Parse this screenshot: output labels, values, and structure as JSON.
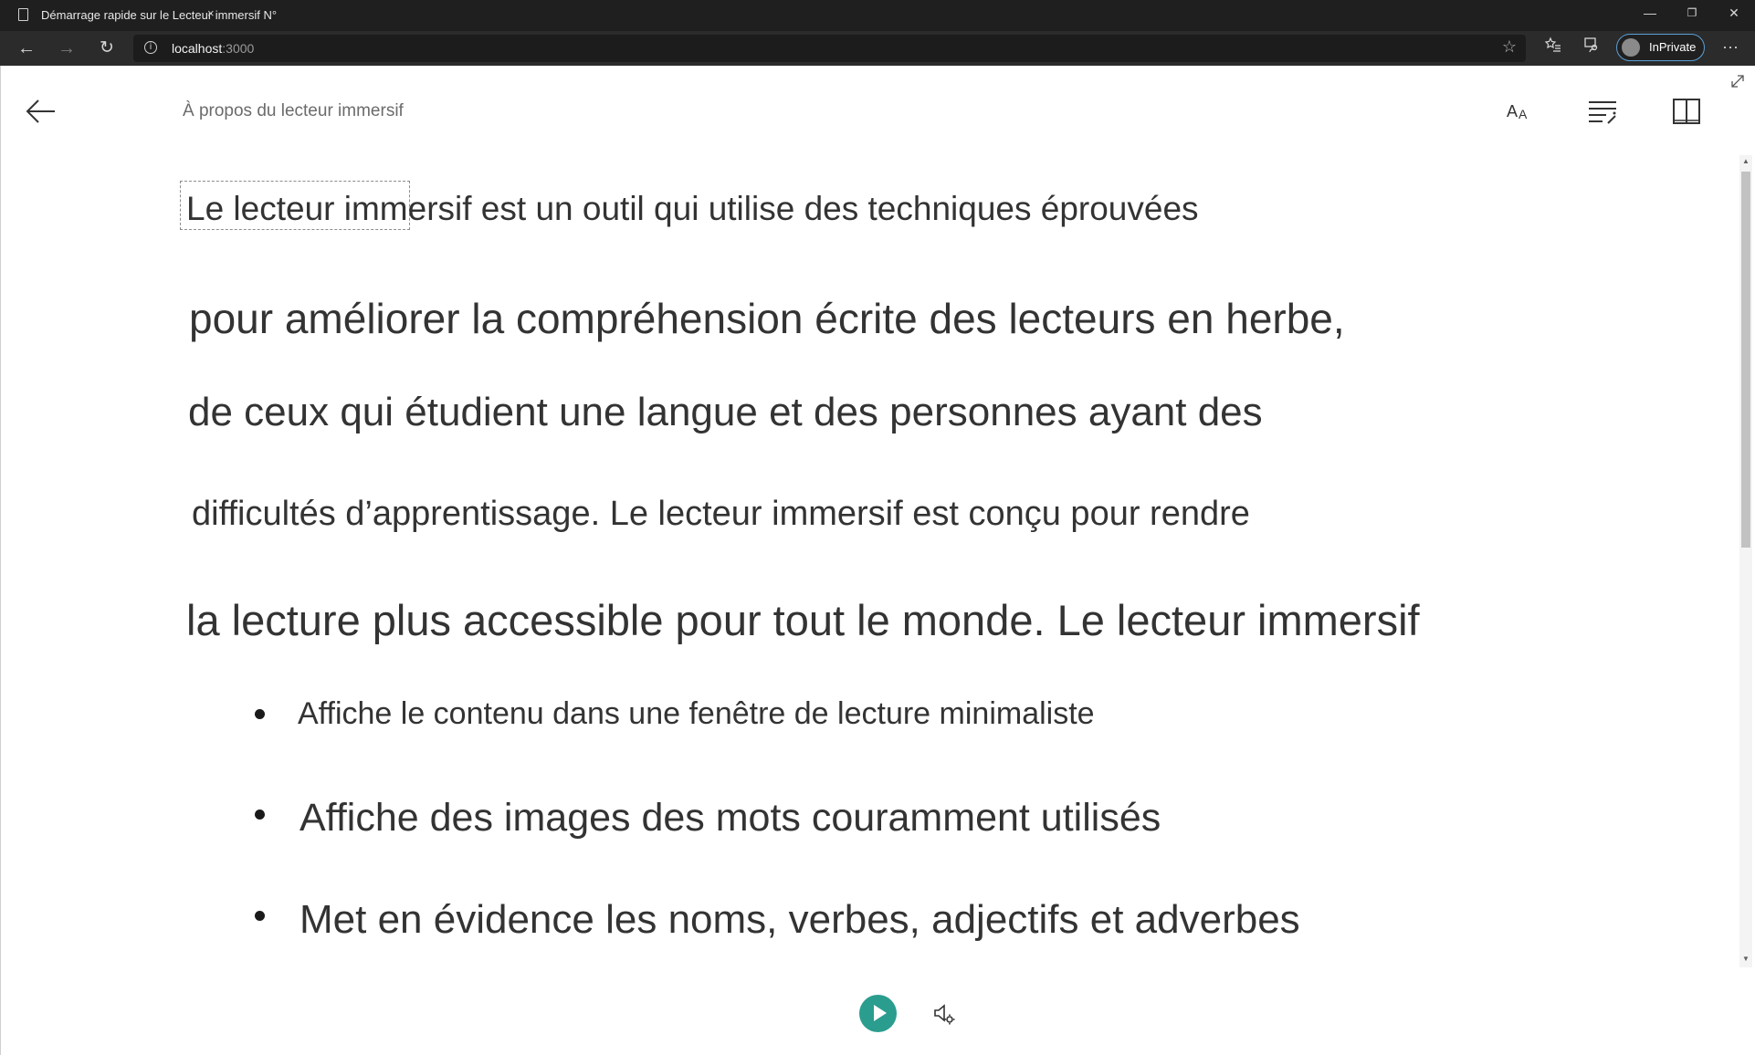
{
  "browser": {
    "tab_title": "Démarrage rapide sur le Lecteur immersif N°",
    "tab_close": "×",
    "minimize": "—",
    "restore": "❐",
    "close": "✕",
    "url_host": "localhost",
    "url_port": ":3000",
    "inprivate_label": "InPrivate",
    "more": "···"
  },
  "reader": {
    "page_title": "À propos du lecteur immersif",
    "lines": [
      "Le lecteur immersif est un outil qui utilise des techniques éprouvées",
      "pour améliorer la compréhension écrite des lecteurs en herbe,",
      "de ceux qui étudient une langue et des personnes ayant des",
      "difficultés d’apprentissage. Le lecteur immersif est conçu pour rendre",
      "la lecture plus accessible pour tout le monde. Le lecteur immersif"
    ],
    "bullets": [
      "Affiche le contenu dans une fenêtre de lecture minimaliste",
      "Affiche des images des mots couramment utilisés",
      "Met en évidence les noms, verbes, adjectifs et adverbes"
    ],
    "colors": {
      "play_button": "#2a9d8f",
      "text": "#333333"
    }
  }
}
